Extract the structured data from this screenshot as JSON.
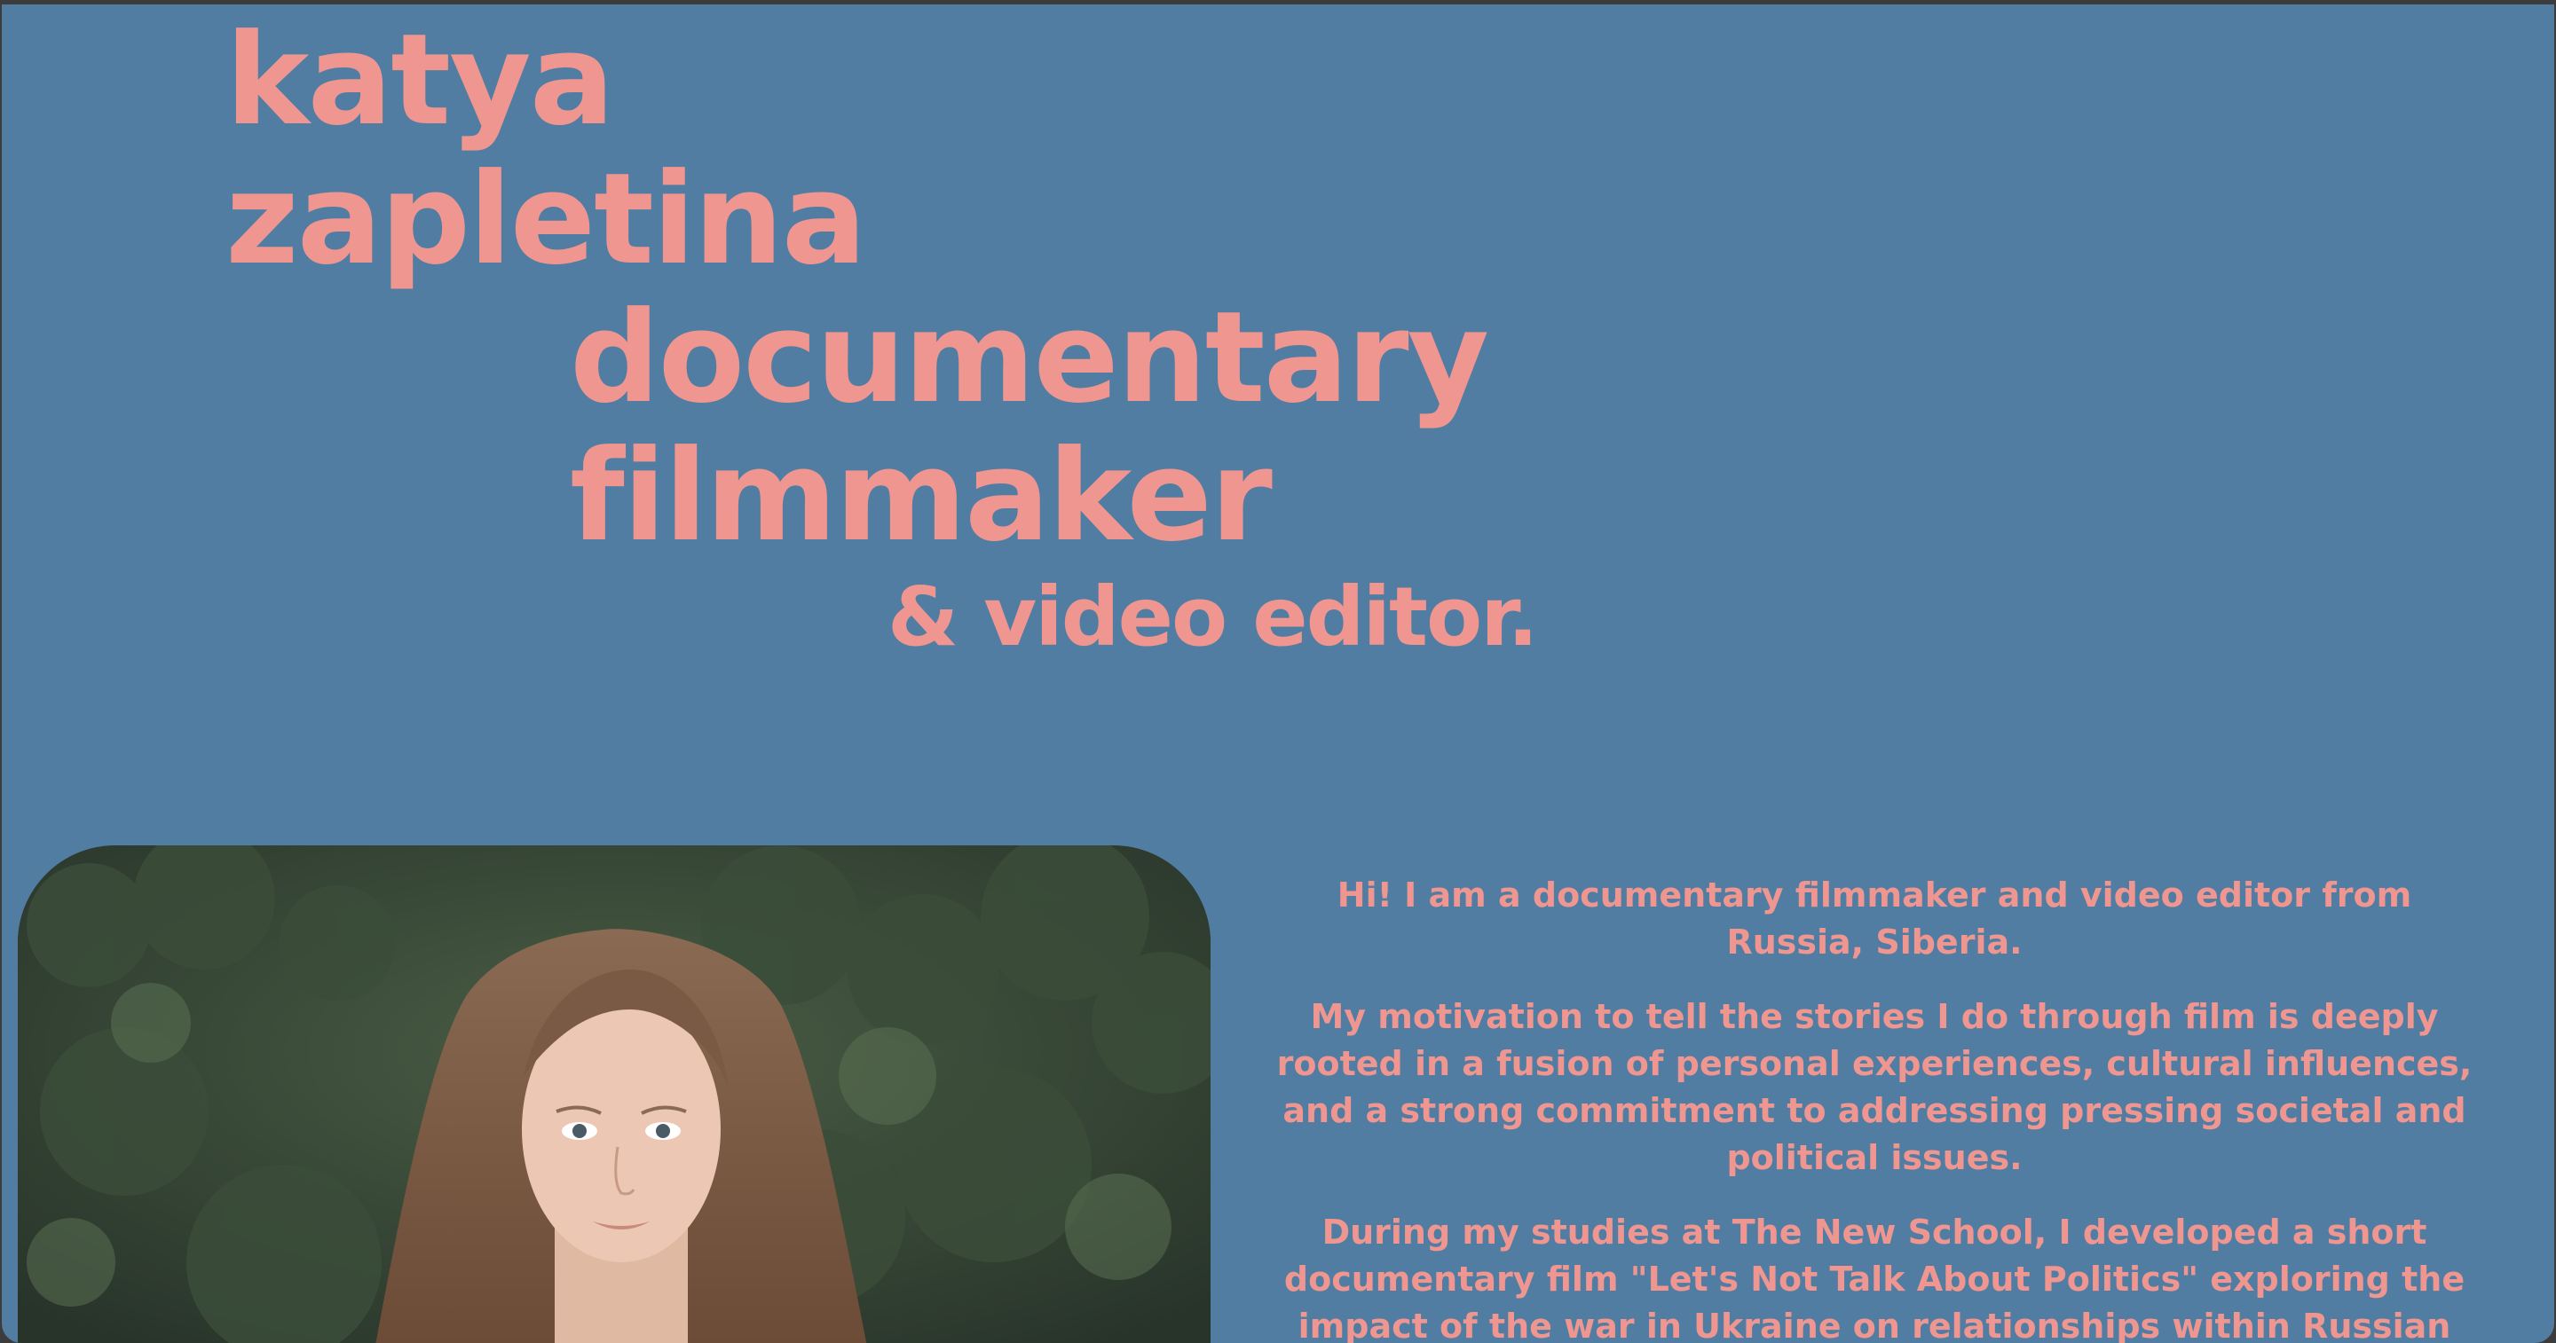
{
  "hero": {
    "line1": "katya",
    "line2": "zapletina",
    "line3": "documentary",
    "line4": "filmmaker",
    "line5": "& video editor."
  },
  "bio": {
    "paragraphs": [
      "Hi! I am a documentary filmmaker and video editor from Russia, Siberia.",
      "My motivation to tell the stories I do through film is deeply rooted in a fusion of personal experiences, cultural influences, and a strong commitment to addressing pressing societal and political issues.",
      "During my studies at The New School, I developed a short documentary film \"Let's Not Talk About Politics\" exploring the impact of the war in Ukraine on relationships within Russian"
    ]
  },
  "colors": {
    "background": "#527da2",
    "accent_text": "#ef9690",
    "window_frame": "#3c3c3c"
  }
}
